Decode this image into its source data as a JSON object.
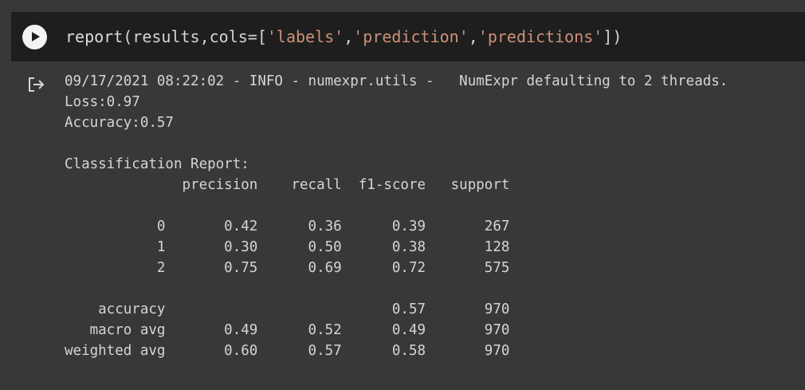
{
  "cell": {
    "code_tokens": [
      {
        "text": "report",
        "kind": "fn"
      },
      {
        "text": "(results,cols=[",
        "kind": "punc"
      },
      {
        "text": "'labels'",
        "kind": "str"
      },
      {
        "text": ",",
        "kind": "punc"
      },
      {
        "text": "'prediction'",
        "kind": "str"
      },
      {
        "text": ",",
        "kind": "punc"
      },
      {
        "text": "'predictions'",
        "kind": "str"
      },
      {
        "text": "])",
        "kind": "punc"
      }
    ],
    "run_icon": "play-icon"
  },
  "output": {
    "icon": "output-redirect-icon",
    "lines": [
      "09/17/2021 08:22:02 - INFO - numexpr.utils -   NumExpr defaulting to 2 threads.",
      "Loss:0.97",
      "Accuracy:0.57",
      "",
      "Classification Report:",
      "              precision    recall  f1-score   support",
      "",
      "           0       0.42      0.36      0.39       267",
      "           1       0.30      0.50      0.38       128",
      "           2       0.75      0.69      0.72       575",
      "",
      "    accuracy                           0.57       970",
      "   macro avg       0.49      0.52      0.49       970",
      "weighted avg       0.60      0.57      0.58       970"
    ]
  },
  "colors": {
    "page_background": "#383838",
    "cell_background": "#1e1e1e",
    "string": "#ce9178",
    "text": "#d5d5d5"
  }
}
